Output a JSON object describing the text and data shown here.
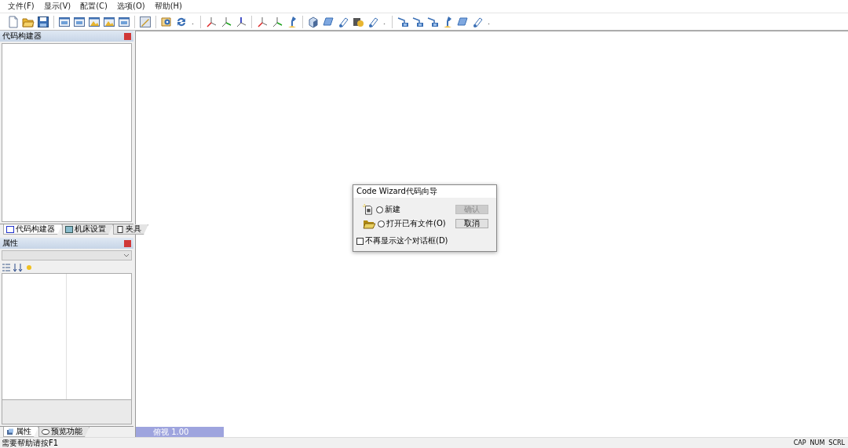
{
  "menu": [
    "文件(F)",
    "显示(V)",
    "配置(C)",
    "选项(O)",
    "帮助(H)"
  ],
  "code_builder": {
    "title": "代码构建器",
    "tabs": [
      {
        "label": "代码构建器",
        "selected": true
      },
      {
        "label": "机床设置",
        "selected": false
      },
      {
        "label": "夹具",
        "selected": false
      }
    ]
  },
  "properties": {
    "title": "属性",
    "tabs": [
      {
        "label": "属性",
        "selected": true
      },
      {
        "label": "预览功能",
        "selected": false
      }
    ]
  },
  "view": {
    "tab": "俯视 1.00"
  },
  "dialog": {
    "title": "Code Wizard代码向导",
    "options": [
      {
        "label": "新建",
        "selected": false
      },
      {
        "label": "打开已有文件(O)",
        "selected": false
      }
    ],
    "buttons": [
      {
        "label": "确认",
        "disabled": true
      },
      {
        "label": "取消",
        "disabled": false
      }
    ],
    "checkbox": {
      "label": "不再显示这个对话框(D)",
      "checked": false
    }
  },
  "status_bar": {
    "message": "需要帮助请按F1",
    "indicators": [
      "CAP",
      "NUM",
      "SCRL"
    ]
  }
}
